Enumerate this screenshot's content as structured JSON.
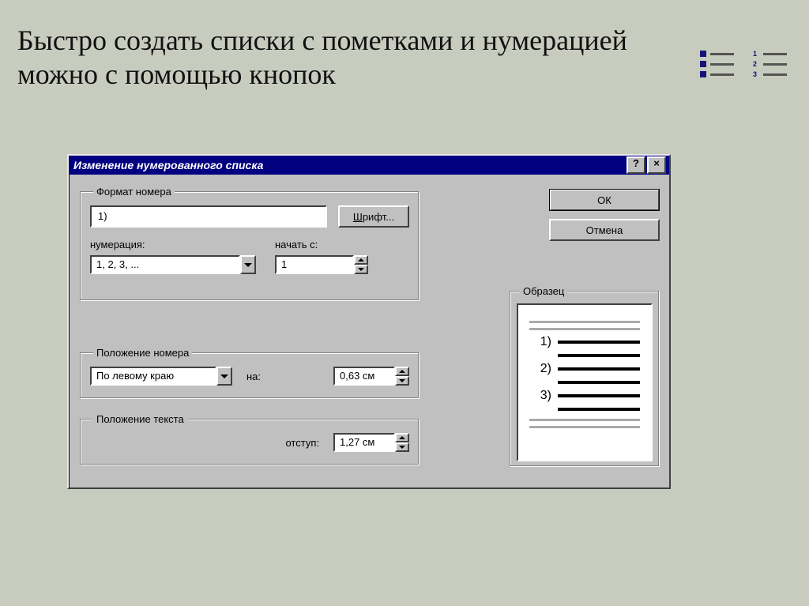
{
  "headline": "Быстро создать списки с пометками и нумерацией можно с помощью кнопок",
  "dialog": {
    "title": "Изменение нумерованного списка",
    "help": "?",
    "close": "×",
    "buttons": {
      "ok": "ОК",
      "cancel": "Отмена"
    },
    "groups": {
      "format": {
        "legend": "Формат номера",
        "value": "1)",
        "font_btn_prefix": "Ш",
        "font_btn_rest": "рифт...",
        "numbering_label": "нумерация:",
        "numbering_value": "1, 2, 3, ...",
        "start_label": "начать с:",
        "start_value": "1"
      },
      "num_position": {
        "legend": "Положение номера",
        "align_value": "По левому краю",
        "at_label": "на:",
        "at_value": "0,63 см"
      },
      "text_position": {
        "legend": "Положение текста",
        "indent_label": "отступ:",
        "indent_value": "1,27 см"
      },
      "preview": {
        "legend": "Образец",
        "items": [
          "1)",
          "2)",
          "3)"
        ]
      }
    }
  }
}
